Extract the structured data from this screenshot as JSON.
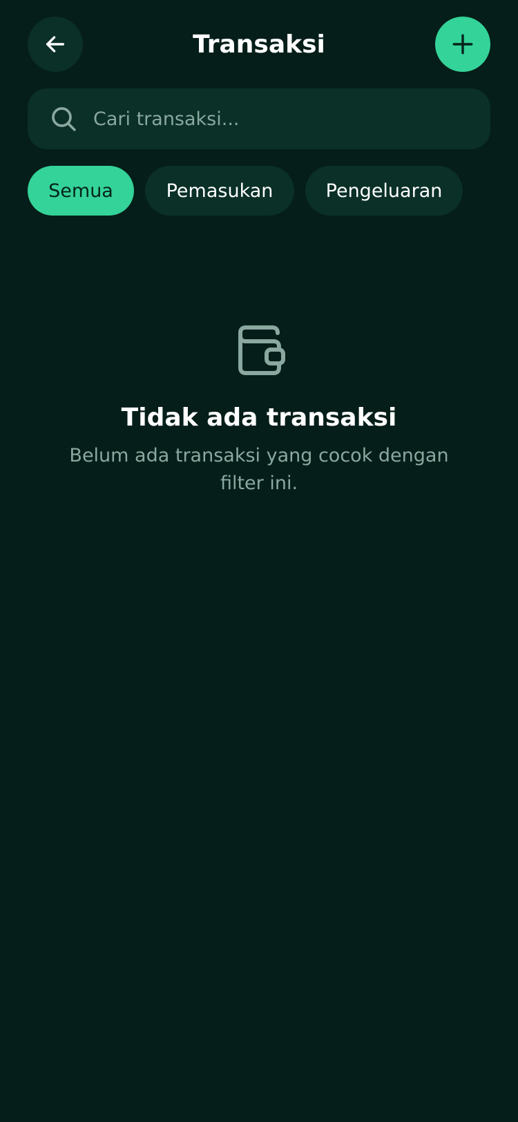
{
  "header": {
    "title": "Transaksi",
    "back_icon": "arrow-left-icon",
    "add_icon": "plus-icon"
  },
  "search": {
    "placeholder": "Cari transaksi...",
    "value": "",
    "icon": "search-icon"
  },
  "filters": {
    "items": [
      {
        "label": "Semua",
        "active": true
      },
      {
        "label": "Pemasukan",
        "active": false
      },
      {
        "label": "Pengeluaran",
        "active": false
      }
    ]
  },
  "empty_state": {
    "icon": "wallet-icon",
    "title": "Tidak ada transaksi",
    "description": "Belum ada transaksi yang cocok dengan filter ini."
  },
  "colors": {
    "background": "#051e19",
    "surface": "#0a3027",
    "accent": "#34d399",
    "muted_text": "#8aa89f"
  }
}
